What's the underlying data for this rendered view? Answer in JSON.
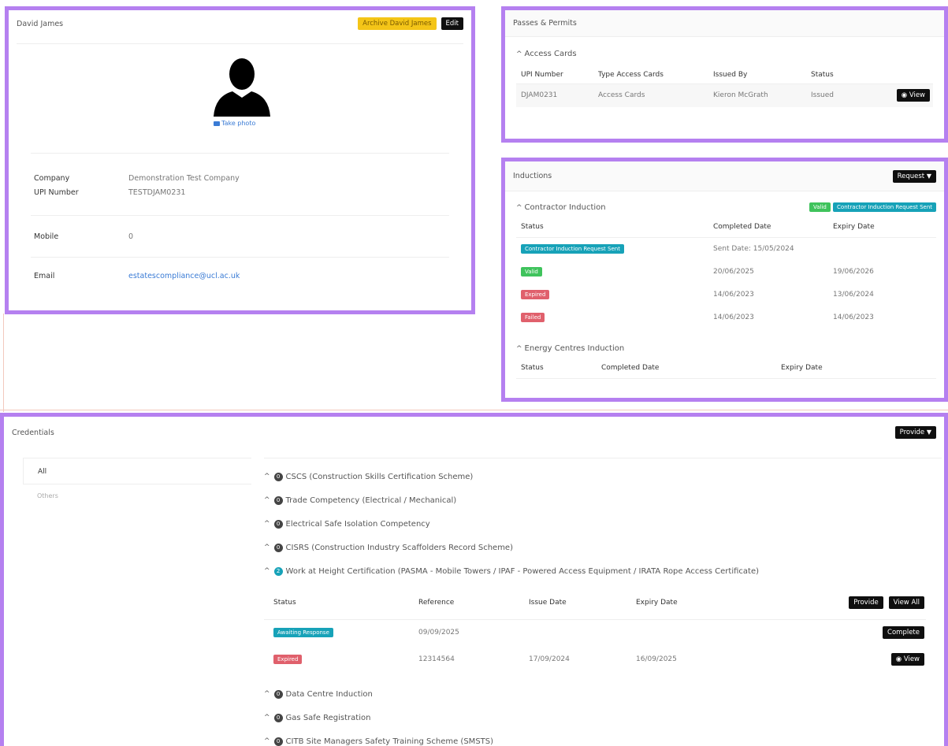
{
  "profile": {
    "name": "David James",
    "archive_label": "Archive David James",
    "edit_label": "Edit",
    "take_photo_label": "Take photo",
    "fields": [
      {
        "label": "Company",
        "value": "Demonstration Test Company"
      },
      {
        "label": "UPI Number",
        "value": "TESTDJAM0231"
      },
      {
        "label": "Mobile",
        "value": "0"
      },
      {
        "label": "Email",
        "value": "estatescompliance@ucl.ac.uk"
      }
    ]
  },
  "passes": {
    "title": "Passes & Permits",
    "section_title": "Access Cards",
    "columns": [
      "UPI Number",
      "Type Access Cards",
      "Issued By",
      "Status"
    ],
    "row": {
      "upi": "DJAM0231",
      "type": "Access Cards",
      "issued_by": "Kieron McGrath",
      "status": "Issued"
    },
    "view_label": "View"
  },
  "inductions": {
    "title": "Inductions",
    "request_label": "Request",
    "contractor": {
      "title": "Contractor Induction",
      "badge_valid": "Valid",
      "badge_sent": "Contractor Induction Request Sent",
      "columns": [
        "Status",
        "Completed Date",
        "Expiry Date"
      ],
      "rows": [
        {
          "status": "Contractor Induction Request Sent",
          "completed": "Sent Date: 15/05/2024",
          "expiry": ""
        },
        {
          "status": "Valid",
          "completed": "20/06/2025",
          "expiry": "19/06/2026"
        },
        {
          "status": "Expired",
          "completed": "14/06/2023",
          "expiry": "13/06/2024"
        },
        {
          "status": "Failed",
          "completed": "14/06/2023",
          "expiry": "14/06/2023"
        }
      ]
    },
    "energy": {
      "title": "Energy Centres Induction",
      "columns": [
        "Status",
        "Completed Date",
        "Expiry Date"
      ]
    }
  },
  "credentials": {
    "title": "Credentials",
    "provide_label": "Provide",
    "tabs": [
      "All",
      "Others"
    ],
    "items_top": [
      {
        "count": "0",
        "label": "CSCS (Construction Skills Certification Scheme)"
      },
      {
        "count": "0",
        "label": "Trade Competency (Electrical / Mechanical)"
      },
      {
        "count": "0",
        "label": "Electrical Safe Isolation Competency"
      },
      {
        "count": "0",
        "label": "CISRS (Construction Industry Scaffolders Record Scheme)"
      },
      {
        "count": "2",
        "label": "Work at Height Certification (PASMA - Mobile Towers / IPAF - Powered Access Equipment / IRATA Rope Access Certificate)"
      }
    ],
    "wah": {
      "columns": [
        "Status",
        "Reference",
        "Issue Date",
        "Expiry Date"
      ],
      "provide_label": "Provide",
      "view_all_label": "View All",
      "rows": [
        {
          "status": "Awaiting Response",
          "reference": "09/09/2025",
          "issue": "",
          "expiry": "",
          "action": "Complete"
        },
        {
          "status": "Expired",
          "reference": "12314564",
          "issue": "17/09/2024",
          "expiry": "16/09/2025",
          "action": "View"
        }
      ]
    },
    "items_bottom": [
      {
        "count": "0",
        "label": "Data Centre Induction"
      },
      {
        "count": "0",
        "label": "Gas Safe Registration"
      },
      {
        "count": "0",
        "label": "CITB Site Managers Safety Training Scheme (SMSTS)"
      }
    ]
  },
  "colors": {
    "accent_frame": "#b580f0",
    "teal": "#17a2b8",
    "green": "#3fc35c",
    "red": "#e0606c",
    "yellow": "#f4c518"
  }
}
